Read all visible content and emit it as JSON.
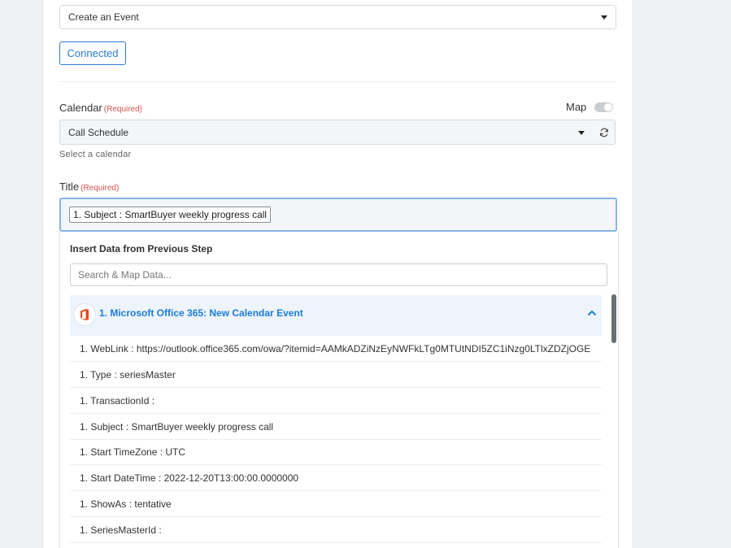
{
  "event_select": {
    "value": "Create an Event"
  },
  "connected_button": {
    "label": "Connected"
  },
  "calendar": {
    "label": "Calendar",
    "required": "(Required)",
    "map_label": "Map",
    "value": "Call Schedule",
    "help": "Select a calendar"
  },
  "title_field": {
    "label": "Title",
    "required": "(Required)",
    "chip": "1. Subject : SmartBuyer weekly progress call"
  },
  "insert_panel": {
    "title": "Insert Data from Previous Step",
    "search_placeholder": "Search & Map Data...",
    "app": {
      "label": "1. Microsoft Office 365: New Calendar Event",
      "icon": "office365-icon",
      "brand_color": "#e64a19"
    },
    "rows": [
      "1. WebLink : https://outlook.office365.com/owa/?itemid=AAMkADZiNzEyNWFkLTg0MTUtNDI5ZC1iNzg0LTlxZDZjOGE",
      "1. Type : seriesMaster",
      "1. TransactionId :",
      "1. Subject : SmartBuyer weekly progress call",
      "1. Start TimeZone : UTC",
      "1. Start DateTime : 2022-12-20T13:00:00.0000000",
      "1. ShowAs : tentative",
      "1. SeriesMasterId :"
    ]
  },
  "colors": {
    "accent": "#2a7bd0",
    "required": "#d9534f",
    "app_header_bg": "#edf4fc"
  }
}
